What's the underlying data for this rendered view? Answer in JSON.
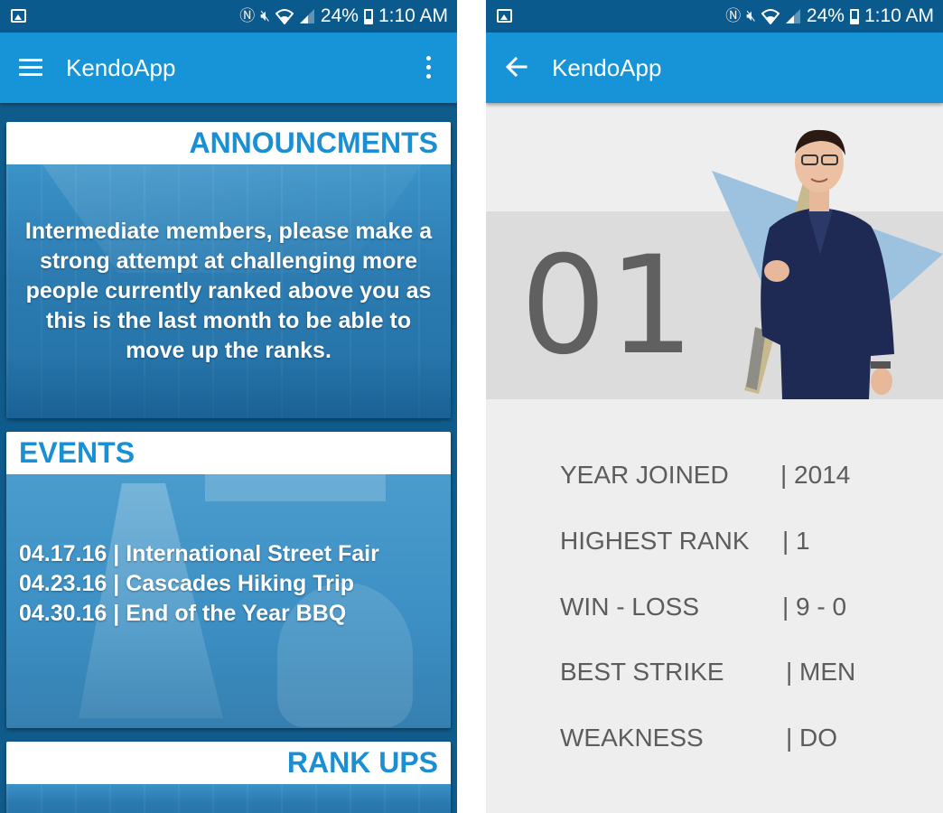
{
  "left_screen": {
    "status_bar": {
      "battery": "24%",
      "time": "1:10 AM"
    },
    "app_bar": {
      "title": "KendoApp"
    },
    "announcements": {
      "header": "ANNOUNCMENTS",
      "text": "Intermediate members, please make a strong attempt at challenging more people currently ranked above you as this is the last month to be able to move up the ranks."
    },
    "events": {
      "header": "EVENTS",
      "items": [
        "04.17.16 | International Street Fair",
        "04.23.16 | Cascades Hiking Trip",
        "04.30.16 | End of the Year BBQ"
      ]
    },
    "rank_ups": {
      "header": "RANK UPS"
    }
  },
  "right_screen": {
    "status_bar": {
      "battery": "24%",
      "time": "1:10 AM"
    },
    "app_bar": {
      "title": "KendoApp"
    },
    "profile": {
      "rank_number": "01",
      "stats": [
        {
          "label": "YEAR JOINED",
          "value": "| 2014"
        },
        {
          "label": "HIGHEST RANK",
          "value": "| 1"
        },
        {
          "label": "WIN - LOSS",
          "value": "| 9 - 0"
        },
        {
          "label": "BEST STRIKE",
          "value": "| MEN"
        },
        {
          "label": "WEAKNESS",
          "value": "| DO"
        }
      ]
    }
  },
  "colors": {
    "app_bar": "#1793d7",
    "status_bar": "#0b5a8e",
    "accent_text": "#1a8fd3",
    "stat_text": "#5c5c5c"
  },
  "icons": [
    "image-icon",
    "nfc-icon",
    "mute-icon",
    "wifi-icon",
    "signal-icon",
    "battery-icon",
    "menu-icon",
    "overflow-menu-icon",
    "back-arrow-icon"
  ]
}
